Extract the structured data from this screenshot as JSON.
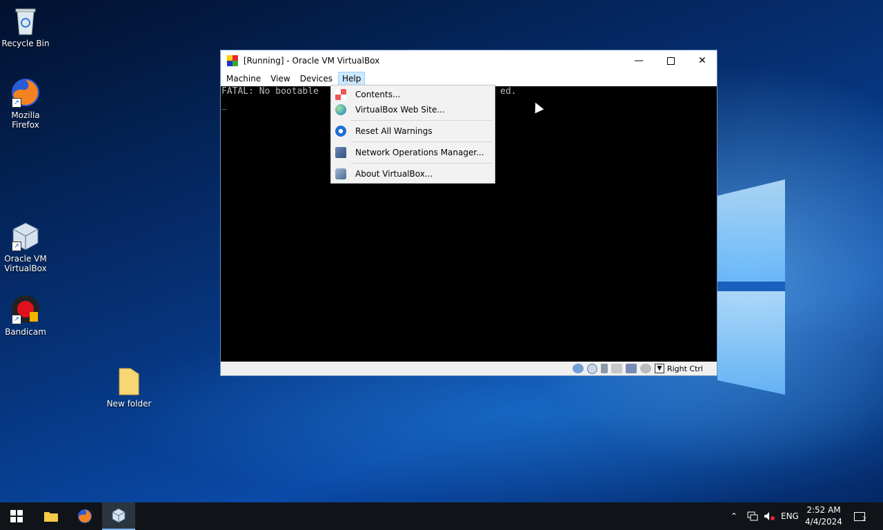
{
  "desktop": {
    "icons": [
      {
        "label": "Recycle Bin"
      },
      {
        "label": "Mozilla Firefox"
      },
      {
        "label": "Oracle VM VirtualBox"
      },
      {
        "label": "Bandicam"
      },
      {
        "label": "New folder"
      }
    ]
  },
  "window": {
    "title": "[Running] - Oracle VM VirtualBox",
    "menu": [
      "Machine",
      "View",
      "Devices",
      "Help"
    ],
    "screen_text_left": "FATAL: No bootable",
    "screen_text_right": "ed.",
    "screen_cursor": "_",
    "host_key": "Right Ctrl"
  },
  "help_menu": {
    "items": [
      {
        "label": "Contents...",
        "icon": "contents-icon"
      },
      {
        "label": "VirtualBox Web Site...",
        "icon": "globe-icon"
      },
      {
        "label": "Reset All Warnings",
        "icon": "reset-icon"
      },
      {
        "label": "Network Operations Manager...",
        "icon": "network-icon"
      },
      {
        "label": "About VirtualBox...",
        "icon": "virtualbox-icon"
      }
    ]
  },
  "taskbar": {
    "tray_lang": "ENG",
    "time": "2:52 AM",
    "date": "4/4/2024",
    "notifications": "2"
  },
  "colors": {
    "menu_highlight": "#cce8ff",
    "taskbar": "#101418"
  }
}
